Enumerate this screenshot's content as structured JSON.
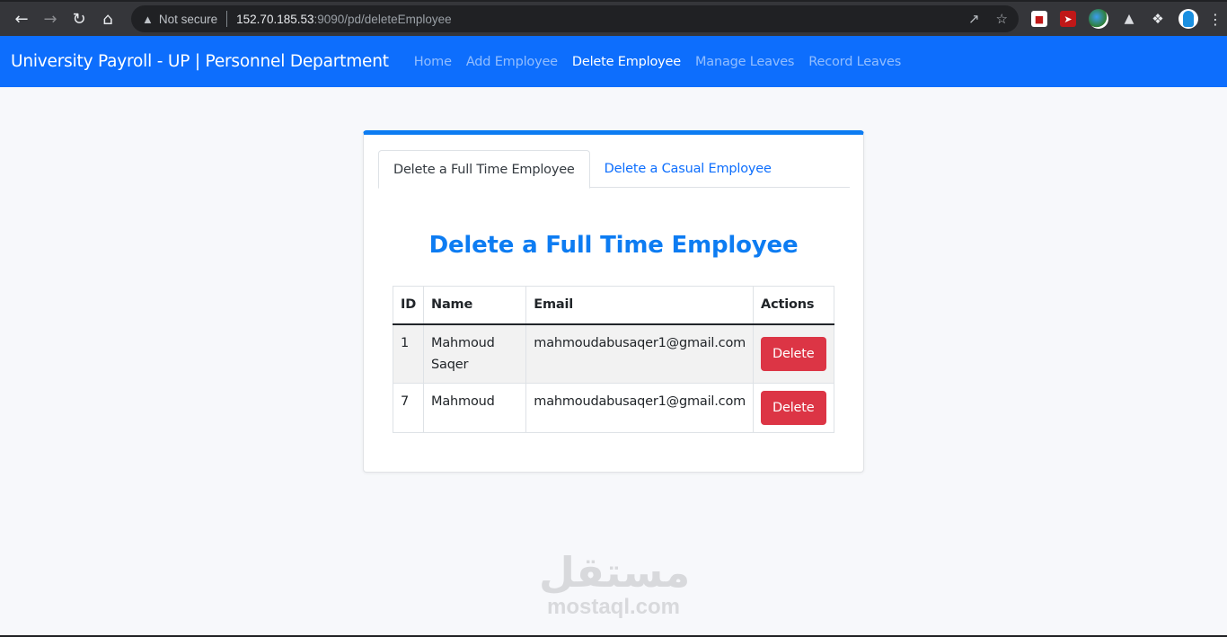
{
  "browser": {
    "security_label": "Not secure",
    "url_host": "152.70.185.53",
    "url_rest": ":9090/pd/deleteEmployee",
    "icons": [
      "back-icon",
      "forward-icon",
      "reload-icon",
      "home-icon",
      "warning-icon",
      "share-icon",
      "star-icon",
      "mcafee-extension-icon",
      "rocket-extension-icon",
      "globe-extension-icon",
      "triangle-extension-icon",
      "puzzle-extension-icon",
      "profile-avatar-icon",
      "menu-icon"
    ]
  },
  "navbar": {
    "brand": "University Payroll - UP | Personnel Department",
    "links": [
      {
        "label": "Home",
        "active": false
      },
      {
        "label": "Add Employee",
        "active": false
      },
      {
        "label": "Delete Employee",
        "active": true
      },
      {
        "label": "Manage Leaves",
        "active": false
      },
      {
        "label": "Record Leaves",
        "active": false
      }
    ]
  },
  "card": {
    "tabs": [
      {
        "label": "Delete a Full Time Employee",
        "active": true
      },
      {
        "label": "Delete a Casual Employee",
        "active": false
      }
    ],
    "title": "Delete a Full Time Employee",
    "table": {
      "headers": [
        "ID",
        "Name",
        "Email",
        "Actions"
      ],
      "rows": [
        {
          "id": "1",
          "name": "Mahmoud Saqer",
          "email": "mahmoudabusaqer1@gmail.com",
          "action": "Delete"
        },
        {
          "id": "7",
          "name": "Mahmoud",
          "email": "mahmoudabusaqer1@gmail.com",
          "action": "Delete"
        }
      ]
    }
  },
  "watermark": {
    "arabic": "مستقل",
    "latin": "mostaql.com"
  },
  "colors": {
    "navbar": "#0d6efd",
    "accent": "#0d7cf2",
    "danger": "#dc3545"
  }
}
